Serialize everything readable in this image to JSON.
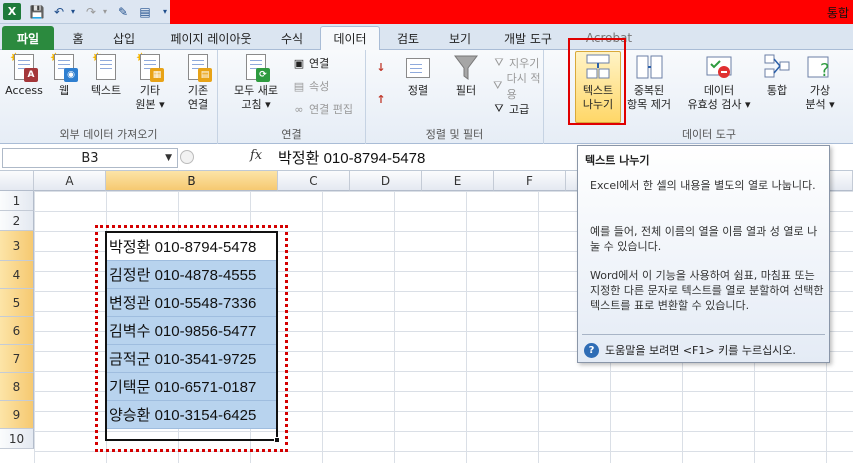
{
  "window_title": "통합",
  "tabs": {
    "file": "파일",
    "home": "홈",
    "insert": "삽입",
    "page_layout": "페이지 레이아웃",
    "formulas": "수식",
    "data": "데이터",
    "review": "검토",
    "view": "보기",
    "developer": "개발 도구",
    "acrobat": "Acrobat"
  },
  "groups": {
    "external": {
      "label": "외부 데이터 가져오기",
      "access": "Access",
      "web": "웹",
      "text": "텍스트",
      "other_1": "기타",
      "other_2": "원본 ▾",
      "existing_1": "기존",
      "existing_2": "연결"
    },
    "connections": {
      "label": "연결",
      "refresh_1": "모두 새로",
      "refresh_2": "고침 ▾",
      "connections": "연결",
      "properties": "속성",
      "edit_links": "연결 편집"
    },
    "sort_filter": {
      "label": "정렬 및 필터",
      "sort": "정렬",
      "filter": "필터",
      "clear": "지우기",
      "reapply": "다시 적용",
      "advanced": "고급"
    },
    "data_tools": {
      "label": "데이터 도구",
      "text_to_cols_1": "텍스트",
      "text_to_cols_2": "나누기",
      "remove_dup_1": "중복된",
      "remove_dup_2": "항목 제거",
      "validation_1": "데이터",
      "validation_2": "유효성 검사 ▾",
      "consolidate": "통합",
      "whatif_1": "가상",
      "whatif_2": "분석 ▾"
    }
  },
  "formula_bar": {
    "name_box": "B3",
    "fx": "fx",
    "value": "박정환 010-8794-5478"
  },
  "columns": [
    "A",
    "B",
    "C",
    "D",
    "E",
    "F"
  ],
  "rows": [
    "1",
    "2",
    "3",
    "4",
    "5",
    "6",
    "7",
    "8",
    "9",
    "10"
  ],
  "cells_b": [
    "박정환 010-8794-5478",
    "김정란 010-4878-4555",
    "변정관 010-5548-7336",
    "김벽수 010-9856-5477",
    "금적군 010-3541-9725",
    "기택문 010-6571-0187",
    "양승환 010-3154-6425"
  ],
  "tooltip": {
    "title": "텍스트 나누기",
    "p1": "Excel에서 한 셀의 내용을 별도의 열로 나눕니다.",
    "p2": "예를 들어, 전체 이름의 열을 이름 열과 성 열로 나눌 수 있습니다.",
    "p3": "Word에서 이 기능을 사용하여 쉼표, 마침표 또는 지정한 다른 문자로 텍스트를 열로 분할하여 선택한 텍스트를 표로 변환할 수 있습니다.",
    "help": "도움말을 보려면 <F1> 키를 누르십시오."
  }
}
